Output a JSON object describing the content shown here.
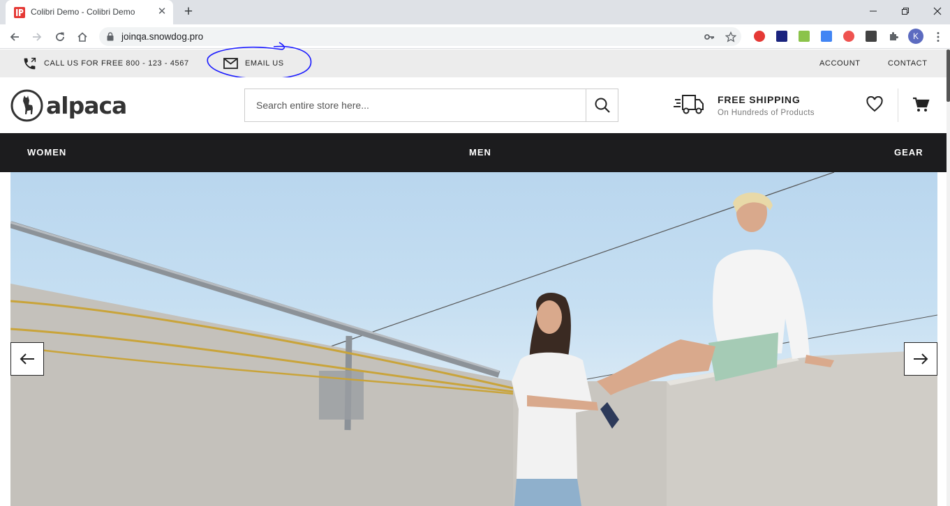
{
  "browser": {
    "tab_title": "Colibri Demo - Colibri Demo",
    "url": "joinqa.snowdog.pro",
    "profile_initial": "K",
    "extensions": [
      "adblock-plus-icon",
      "extension-icon",
      "extension-icon",
      "google-translate-icon",
      "shield-extension-icon",
      "selenium-icon",
      "extensions-puzzle-icon"
    ]
  },
  "topbar": {
    "phone_label": "CALL US FOR FREE 800 - 123 - 4567",
    "email_label": "EMAIL US",
    "account_label": "ACCOUNT",
    "contact_label": "CONTACT"
  },
  "header": {
    "logo_text": "alpaca",
    "search_placeholder": "Search entire store here...",
    "shipping_title": "FREE SHIPPING",
    "shipping_subtitle": "On Hundreds of Products"
  },
  "nav": {
    "items": [
      {
        "label": "WOMEN"
      },
      {
        "label": "MEN"
      },
      {
        "label": "GEAR"
      }
    ]
  },
  "hero": {
    "image_description": "two-people-on-concrete-rooftop-photo"
  },
  "colors": {
    "nav_bg": "#1c1c1e",
    "topbar_bg": "#ececec",
    "annotation": "#1a1aff"
  }
}
